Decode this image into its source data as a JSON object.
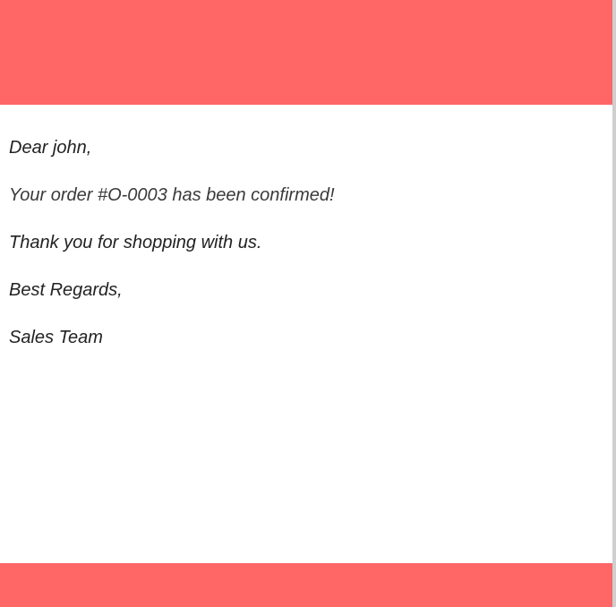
{
  "colors": {
    "header_band": "#ff6666",
    "footer_band": "#ff6666",
    "text": "#222222"
  },
  "email": {
    "greeting": "Dear john,",
    "confirmation": "Your order #O-0003 has been confirmed!",
    "thanks": "Thank you for shopping with us.",
    "closing": "Best Regards,",
    "signature": "Sales Team"
  }
}
